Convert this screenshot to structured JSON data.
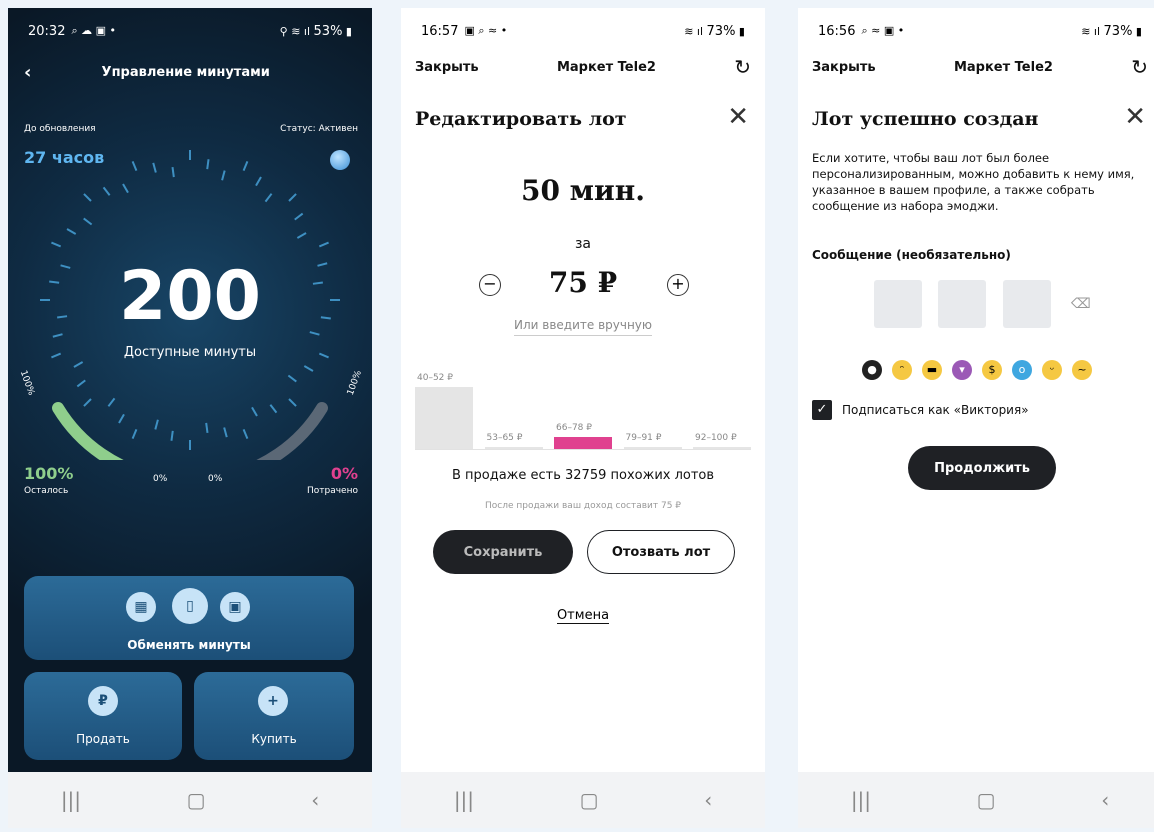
{
  "screen1": {
    "status": {
      "time": "20:32",
      "battery": "53%"
    },
    "title": "Управление минутами",
    "until_update_label": "До обновления",
    "until_update_value": "27 часов",
    "status_label": "Статус: Активен",
    "minutes": "200",
    "minutes_label": "Доступные минуты",
    "left_pct_axis": "100%",
    "right_pct_axis": "100%",
    "left_zero": "0%",
    "right_zero": "0%",
    "remaining_value": "100%",
    "remaining_label": "Осталось",
    "spent_value": "0%",
    "spent_label": "Потрачено",
    "exchange_label": "Обменять минуты",
    "sell_label": "Продать",
    "buy_label": "Купить",
    "remaining_fraction": 1.0,
    "spent_fraction": 0.0,
    "colors": {
      "remaining": "#8fce8c",
      "spent": "#6a7784",
      "accent": "#5fb6f0"
    }
  },
  "screen2": {
    "status": {
      "time": "16:57",
      "battery": "73%"
    },
    "close": "Закрыть",
    "market": "Маркет Tele2",
    "heading": "Редактировать лот",
    "amount": "50 мин.",
    "for": "за",
    "price": "75 ₽",
    "manual": "Или введите вручную",
    "bars": [
      {
        "label": "40–52 ₽",
        "value": 1.0
      },
      {
        "label": "53–65 ₽",
        "value": 0.02
      },
      {
        "label": "66–78 ₽",
        "value": 0.2
      },
      {
        "label": "79–91 ₽",
        "value": 0.02
      },
      {
        "label": "92–100 ₽",
        "value": 0.02
      }
    ],
    "similar": "В продаже есть 32759 похожих лотов",
    "income": "После продажи ваш доход составит 75 ₽",
    "save": "Сохранить",
    "withdraw": "Отозвать лот",
    "cancel": "Отмена",
    "colors": {
      "highlight": "#e0418f",
      "bar": "#e5e5e5"
    }
  },
  "screen3": {
    "status": {
      "time": "16:56",
      "battery": "73%"
    },
    "close": "Закрыть",
    "market": "Маркет Tele2",
    "heading": "Лот успешно создан",
    "description": "Если хотите, чтобы ваш лот был более персонализированным, можно добавить к нему имя, указанное в вашем профиле, а также собрать сообщение из набора эмоджи.",
    "message_label": "Сообщение (необязательно)",
    "emojis": [
      "bomb",
      "cat",
      "cool",
      "devil",
      "money",
      "scream",
      "tongue",
      "sick"
    ],
    "sign_as": "Подписаться как «Виктория»",
    "continue": "Продолжить"
  }
}
